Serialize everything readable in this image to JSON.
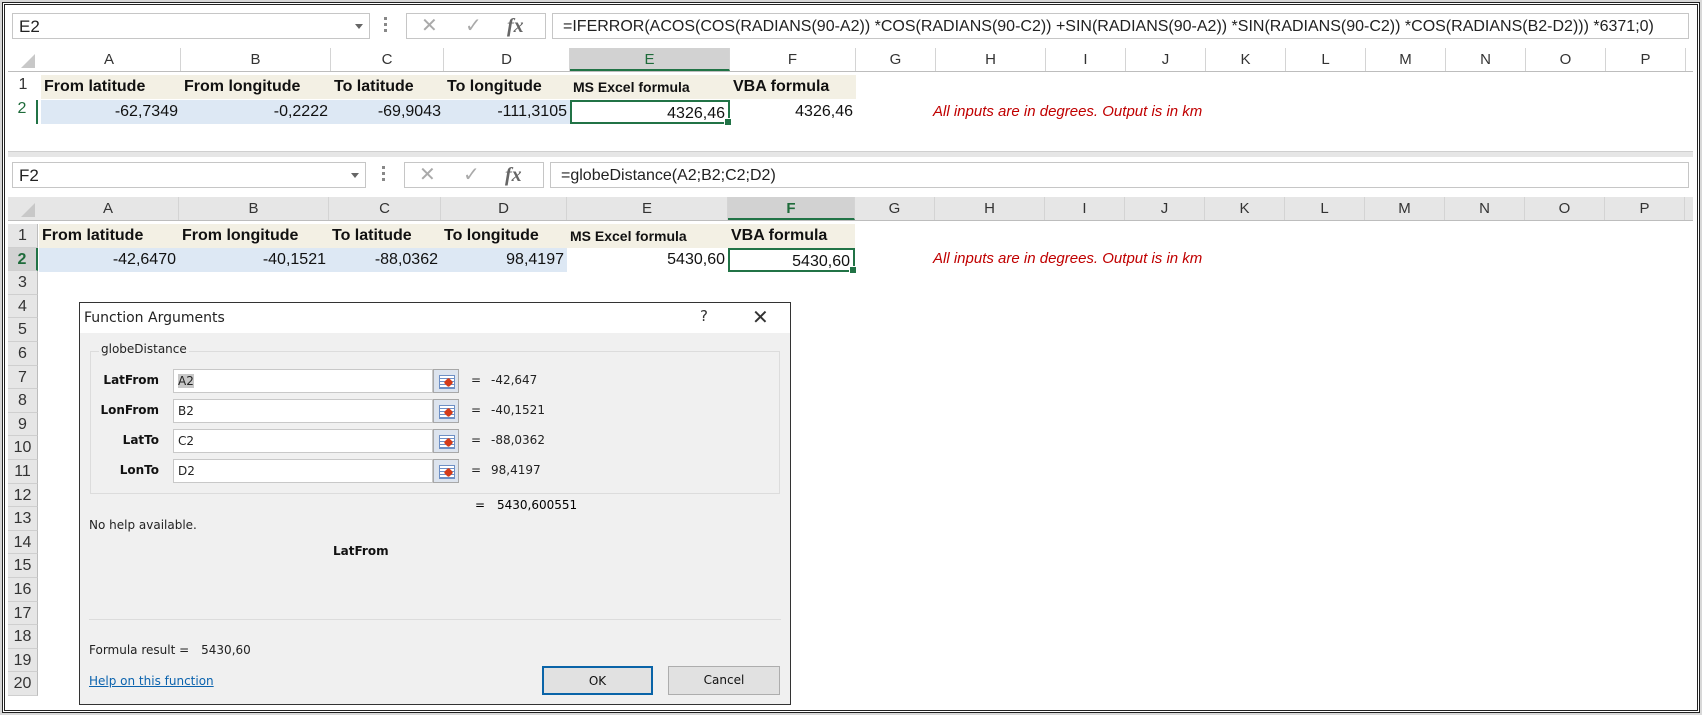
{
  "window_top": {
    "name_box": "E2",
    "formula": "=IFERROR(ACOS(COS(RADIANS(90-A2)) *COS(RADIANS(90-C2)) +SIN(RADIANS(90-A2)) *SIN(RADIANS(90-C2)) *COS(RADIANS(B2-D2))) *6371;0)",
    "columns": [
      "A",
      "B",
      "C",
      "D",
      "E",
      "F",
      "G",
      "H",
      "I",
      "J",
      "K",
      "L",
      "M",
      "N",
      "O",
      "P"
    ],
    "selected_column": "E",
    "rows": [
      "1",
      "2"
    ],
    "headers": [
      "From latitude",
      "From longitude",
      "To latitude",
      "To longitude",
      "MS Excel formula",
      "VBA formula"
    ],
    "values": [
      "-62,7349",
      "-0,2222",
      "-69,9043",
      "-111,3105",
      "4326,46",
      "4326,46"
    ],
    "note": "All inputs are in degrees. Output is in km"
  },
  "window_bottom": {
    "name_box": "F2",
    "formula": "=globeDistance(A2;B2;C2;D2)",
    "columns": [
      "A",
      "B",
      "C",
      "D",
      "E",
      "F",
      "G",
      "H",
      "I",
      "J",
      "K",
      "L",
      "M",
      "N",
      "O",
      "P"
    ],
    "selected_column": "F",
    "rows": [
      "1",
      "2",
      "3",
      "4",
      "5",
      "6",
      "7",
      "8",
      "9",
      "10",
      "11",
      "12",
      "13",
      "14",
      "15",
      "16",
      "17",
      "18",
      "19",
      "20"
    ],
    "headers": [
      "From latitude",
      "From longitude",
      "To latitude",
      "To longitude",
      "MS Excel formula",
      "VBA formula"
    ],
    "values": [
      "-42,6470",
      "-40,1521",
      "-88,0362",
      "98,4197",
      "5430,60",
      "5430,60"
    ],
    "note": "All inputs are in degrees. Output is in km"
  },
  "formula_bar_icons": {
    "cancel": "✕",
    "enter": "✓",
    "fx": "fx"
  },
  "dialog": {
    "title": "Function Arguments",
    "help_icon": "?",
    "close_icon": "✕",
    "function_name": "globeDistance",
    "args": [
      {
        "label": "LatFrom",
        "input": "A2",
        "value": "-42,647"
      },
      {
        "label": "LonFrom",
        "input": "B2",
        "value": "-40,1521"
      },
      {
        "label": "LatTo",
        "input": "C2",
        "value": "-88,0362"
      },
      {
        "label": "LonTo",
        "input": "D2",
        "value": "98,4197"
      }
    ],
    "eq": "=",
    "result_value": "5430,600551",
    "no_help": "No help available.",
    "current_arg": "LatFrom",
    "formula_result_label": "Formula result =",
    "formula_result_value": "5430,60",
    "help_link": "Help on this function",
    "ok_label": "OK",
    "cancel_label": "Cancel"
  }
}
